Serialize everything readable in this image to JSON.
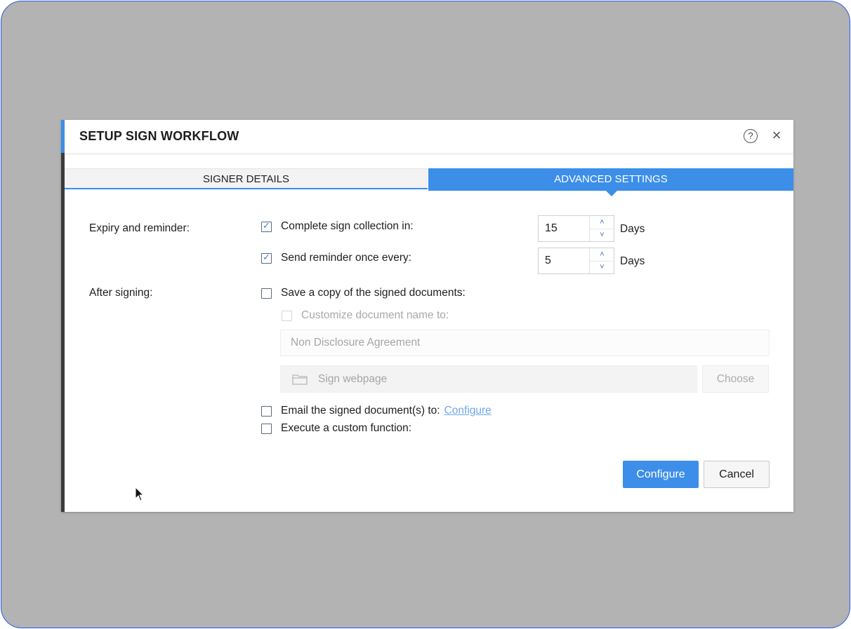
{
  "dialog": {
    "title": "SETUP SIGN WORKFLOW",
    "help_icon": "question-circle-icon",
    "close_icon": "close-icon",
    "close_glyph": "×",
    "help_glyph": "?"
  },
  "tabs": [
    {
      "label": "SIGNER DETAILS",
      "active": false
    },
    {
      "label": "ADVANCED SETTINGS",
      "active": true
    }
  ],
  "sections": {
    "expiry_label": "Expiry and reminder:",
    "after_label": "After signing:"
  },
  "expiry": {
    "complete": {
      "label": "Complete sign collection in:",
      "checked": true,
      "value": "15",
      "unit": "Days"
    },
    "reminder": {
      "label": "Send reminder once every:",
      "checked": true,
      "value": "5",
      "unit": "Days"
    }
  },
  "after": {
    "save_copy": {
      "label": "Save a copy of the signed documents:",
      "checked": false
    },
    "customize_name": {
      "label": "Customize document name to:",
      "checked": false,
      "disabled": true
    },
    "document_name": "Non Disclosure Agreement",
    "folder": "Sign webpage",
    "choose_label": "Choose",
    "email": {
      "label": "Email the signed document(s) to:",
      "checked": false,
      "link": "Configure"
    },
    "custom_function": {
      "label": "Execute a custom function:",
      "checked": false
    }
  },
  "footer": {
    "configure_label": "Configure",
    "cancel_label": "Cancel"
  },
  "colors": {
    "accent": "#3d8ee8",
    "backdrop": "#b3b3b3",
    "frame_border": "#2f5be0"
  }
}
